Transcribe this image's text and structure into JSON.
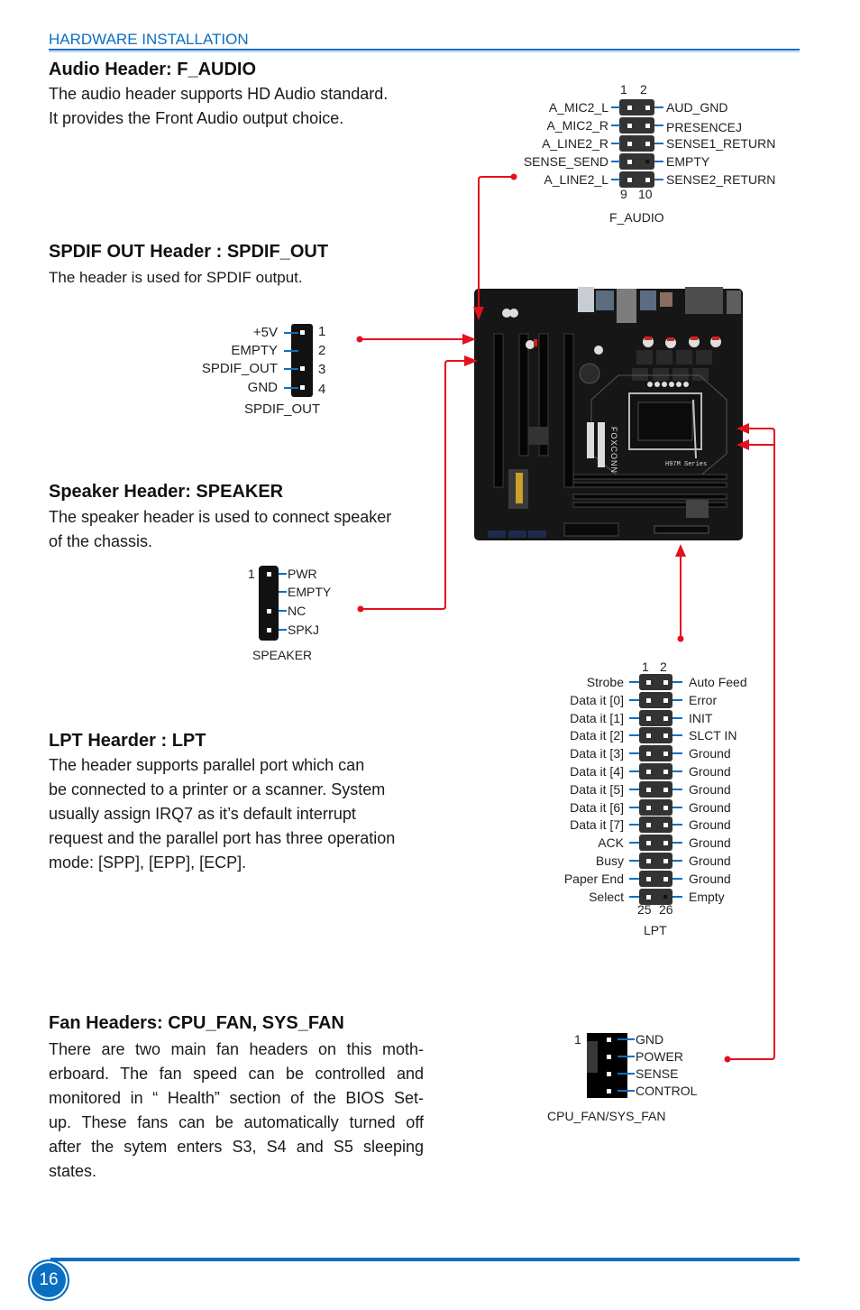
{
  "header": {
    "section": "HARDWARE INSTALLATION"
  },
  "sections": {
    "audio": {
      "title": "Audio Header: F_AUDIO",
      "lines": [
        "The audio header supports HD Audio standard.",
        "It provides the Front Audio output choice."
      ]
    },
    "spdif": {
      "title": "SPDIF OUT Header : SPDIF_OUT",
      "lines": [
        "The header is used for SPDIF output."
      ]
    },
    "speaker": {
      "title": "Speaker Header: SPEAKER",
      "lines": [
        "The speaker header is used to connect speaker",
        "of the chassis."
      ]
    },
    "lpt": {
      "title": "LPT Hearder : LPT",
      "lines": [
        "The header supports parallel port which can",
        "be connected to a printer or a scanner. System",
        "usually assign IRQ7 as it’s default interrupt",
        "request and the parallel port has three operation",
        "mode: [SPP], [EPP], [ECP]."
      ]
    },
    "fan": {
      "title": "Fan Headers: CPU_FAN, SYS_FAN",
      "body": "There are two main fan headers on this motherboard. The fan speed can be controlled and monitored in “ Health” section of the BIOS Setup. These fans can be automatically turned off after the sytem enters S3, S4 and S5 sleeping states.",
      "lines": [
        "There are two main fan headers on this moth-",
        "erboard. The fan speed can be controlled and",
        "monitored in “ Health” section of the BIOS Set-",
        "up. These fans can be automatically turned off",
        "after the sytem enters S3, S4 and S5 sleeping",
        "states."
      ]
    }
  },
  "diagrams": {
    "f_audio": {
      "caption": "F_AUDIO",
      "top_pins": [
        "1",
        "2"
      ],
      "bottom_pins": [
        "9",
        "10"
      ],
      "left": [
        "A_MIC2_L",
        "A_MIC2_R",
        "A_LINE2_R",
        "SENSE_SEND",
        "A_LINE2_L"
      ],
      "right": [
        "AUD_GND",
        "PRESENCEJ",
        "SENSE1_RETURN",
        "EMPTY",
        "SENSE2_RETURN"
      ]
    },
    "spdif_out": {
      "caption": "SPDIF_OUT",
      "labels": [
        "+5V",
        "EMPTY",
        "SPDIF_OUT",
        "GND"
      ],
      "pins": [
        "1",
        "2",
        "3",
        "4"
      ]
    },
    "speaker": {
      "caption": "SPEAKER",
      "first_pin": "1",
      "labels": [
        "PWR",
        "EMPTY",
        "NC",
        "SPKJ"
      ]
    },
    "lpt": {
      "caption": "LPT",
      "top_pins": [
        "1",
        "2"
      ],
      "bottom_pins": [
        "25",
        "26"
      ],
      "left": [
        "Strobe",
        "Data it [0]",
        "Data it [1]",
        "Data it [2]",
        "Data it [3]",
        "Data it [4]",
        "Data it [5]",
        "Data it [6]",
        "Data it [7]",
        "ACK",
        "Busy",
        "Paper End",
        "Select"
      ],
      "right": [
        "Auto Feed",
        "Error",
        "INIT",
        "SLCT IN",
        "Ground",
        "Ground",
        "Ground",
        "Ground",
        "Ground",
        "Ground",
        "Ground",
        "Ground",
        "Empty"
      ]
    },
    "fan": {
      "caption": "CPU_FAN/SYS_FAN",
      "first_pin": "1",
      "labels": [
        "GND",
        "POWER",
        "SENSE",
        "CONTROL"
      ]
    },
    "motherboard": {
      "brand_text": "FOXCONN",
      "series_text": "H97M Series"
    }
  },
  "colors": {
    "accent": "#0a6fc2",
    "callout": "#e3101d",
    "pin_block": "#333333"
  },
  "footer": {
    "page_number": "16"
  }
}
